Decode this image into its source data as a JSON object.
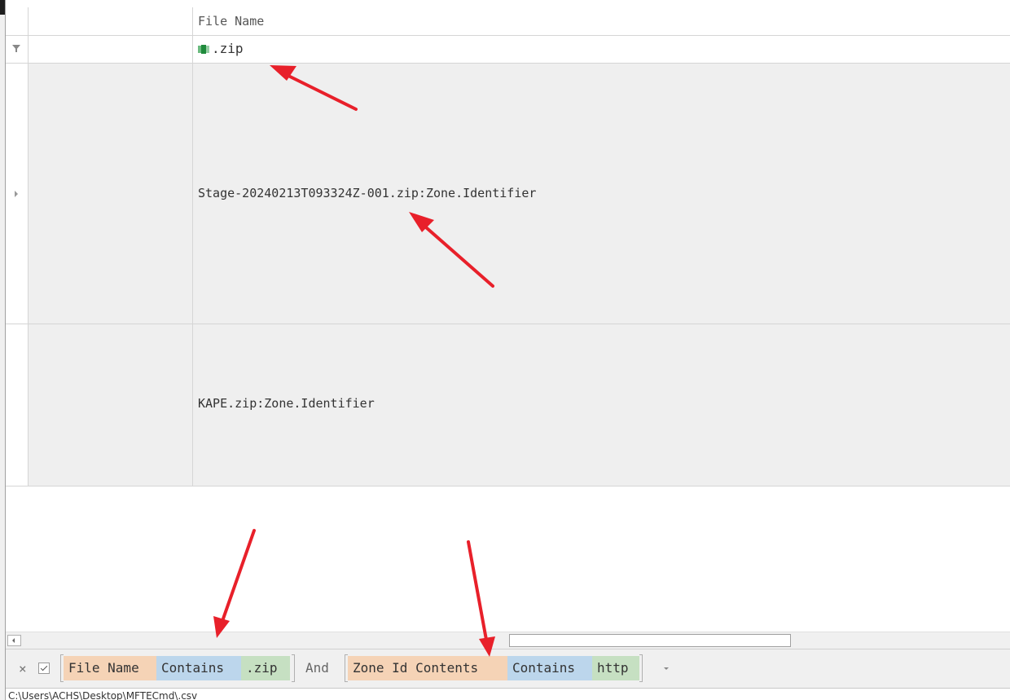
{
  "grid": {
    "columns": [
      {
        "label": ""
      },
      {
        "label": "File Name"
      }
    ],
    "filter_value": ".zip",
    "rows": [
      {
        "file_name": "Stage-20240213T093324Z-001.zip:Zone.Identifier"
      },
      {
        "file_name": "KAPE.zip:Zone.Identifier"
      }
    ]
  },
  "filter_bar": {
    "close_glyph": "×",
    "enabled": true,
    "conditions": [
      {
        "field": "File Name",
        "operator": "Contains",
        "value": ".zip"
      },
      {
        "field": "Zone Id Contents",
        "operator": "Contains",
        "value": "http"
      }
    ],
    "join": "And"
  },
  "status": {
    "path": "C:\\Users\\ACHS\\Desktop\\MFTECmd\\.csv"
  },
  "colors": {
    "annotation_arrow": "#e8202a",
    "field_chip": "#f5d3b6",
    "operator_chip": "#bcd6ec",
    "value_chip": "#c6e0c2",
    "row_background": "#efefef"
  },
  "icons": {
    "filter_row": "funnel-icon",
    "filter_cell": "text-abc-icon",
    "row_indicator": "expand-arrow-icon"
  }
}
